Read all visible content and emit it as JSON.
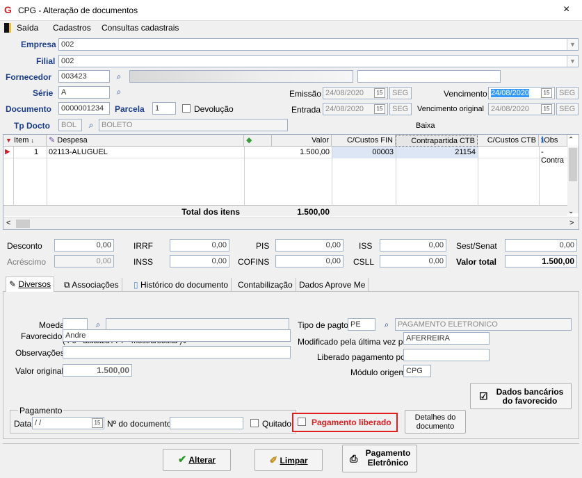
{
  "window": {
    "title": "CPG - Alteração de documentos",
    "close": "×"
  },
  "menu": [
    "Saída",
    "Cadastros",
    "Consultas cadastrais"
  ],
  "header": {
    "empresa_label": "Empresa",
    "empresa": "002",
    "filial_label": "Filial",
    "filial": "002",
    "fornecedor_label": "Fornecedor",
    "fornecedor": "003423",
    "serie_label": "Série",
    "serie": "A",
    "documento_label": "Documento",
    "documento": "0000001234",
    "parcela_label": "Parcela",
    "parcela": "1",
    "devolucao_label": "Devolução",
    "tpdocto_label": "Tp Docto",
    "tpdocto": "BOL",
    "tpdocto_desc": "BOLETO",
    "emissao_label": "Emissão",
    "emissao": "24/08/2020",
    "emissao_day": "SEG",
    "entrada_label": "Entrada",
    "entrada": "24/08/2020",
    "entrada_day": "SEG",
    "vencimento_label": "Vencimento",
    "vencimento": "24/08/2020",
    "vencimento_day": "SEG",
    "venc_orig_label": "Vencimento original",
    "venc_orig": "24/08/2020",
    "venc_orig_day": "SEG",
    "baixa_label": "Baixa"
  },
  "grid": {
    "cols": [
      "Item",
      "Despesa",
      "",
      "Valor",
      "C/Custos FIN",
      "Contrapartida CTB",
      "C/Custos CTB",
      "Obs"
    ],
    "row": {
      "item": "1",
      "despesa": "02113-ALUGUEL",
      "valor": "1.500,00",
      "ccfin": "00003",
      "contrapartida": "21154",
      "ccctb": "",
      "obs": "- Contra"
    },
    "total_label": "Total dos itens",
    "total": "1.500,00"
  },
  "taxes": {
    "desconto_label": "Desconto",
    "desconto": "0,00",
    "acrescimo_label": "Acréscimo",
    "acrescimo": "0,00",
    "irrf_label": "IRRF",
    "irrf": "0,00",
    "inss_label": "INSS",
    "inss": "0,00",
    "pis_label": "PIS",
    "pis": "0,00",
    "cofins_label": "COFINS",
    "cofins": "0,00",
    "iss_label": "ISS",
    "iss": "0,00",
    "csll_label": "CSLL",
    "csll": "0,00",
    "sest_label": "Sest/Senat",
    "sest": "0,00",
    "total_label": "Valor total",
    "total": "1.500,00"
  },
  "tabs": [
    "Diversos",
    "Associações",
    "Histórico do documento",
    "Contabilização",
    "Dados Aprove Me"
  ],
  "diversos": {
    "moeda_label": "Moeda",
    "hint": "( F6 - atualiza / F7 - mostra/oculta )",
    "favorecido_label": "Favorecido",
    "favorecido": "Andre",
    "obs_label": "Observações",
    "valor_original_label": "Valor original",
    "valor_original": "1.500,00",
    "tipo_pagto_label": "Tipo de pagto",
    "tipo_pagto": "PE",
    "tipo_pagto_desc": "PAGAMENTO ELETRONICO",
    "modificado_label": "Modificado pela última vez por",
    "modificado": "AFERREIRA",
    "liberado_label": "Liberado pagamento por",
    "modulo_label": "Módulo origem",
    "modulo": "CPG",
    "dados_bancarios": "Dados bancários do favorecido",
    "pagamento_label": "Pagamento",
    "data_label": "Data",
    "data": " / /",
    "ndoc_label": "Nº do documento",
    "quitado_label": "Quitado",
    "pag_liberado_label": "Pagamento liberado",
    "detalhes": "Detalhes do documento"
  },
  "footer": {
    "alterar": "Alterar",
    "limpar": "Limpar",
    "pagamento_eletronico": "Pagamento Eletrônico"
  },
  "colors": {
    "label_blue": "#1c3e8a",
    "highlight": "#e02020",
    "selection": "#3399ff"
  }
}
